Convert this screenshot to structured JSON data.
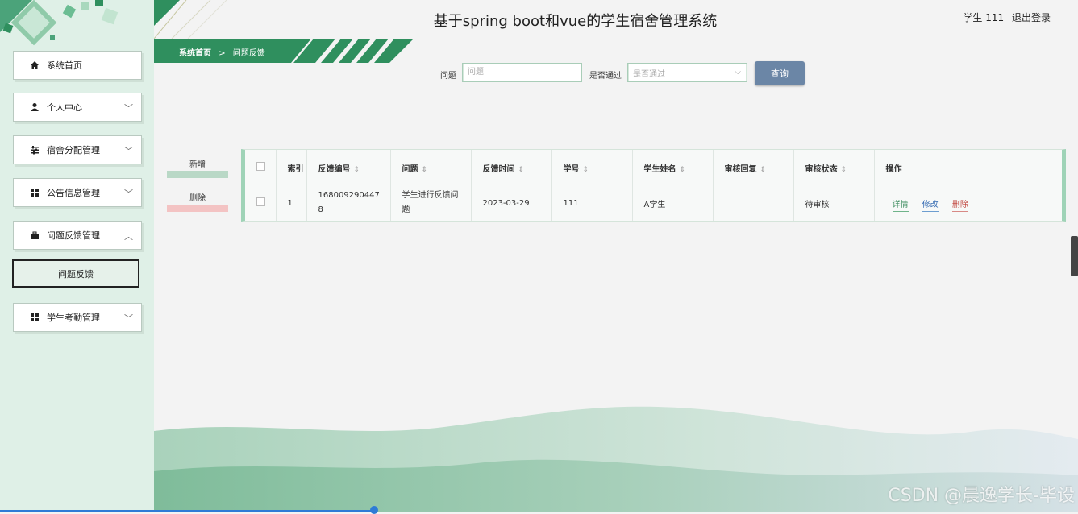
{
  "header": {
    "title": "基于spring boot和vue的学生宿舍管理系统",
    "user": "学生 111",
    "logout": "退出登录"
  },
  "breadcrumb": {
    "home": "系统首页",
    "separator": ">",
    "current": "问题反馈"
  },
  "sidebar": {
    "items": [
      {
        "label": "系统首页",
        "icon": "home-icon"
      },
      {
        "label": "个人中心",
        "icon": "user-icon",
        "arrow": "﹀"
      },
      {
        "label": "宿舍分配管理",
        "icon": "sliders-icon",
        "arrow": "﹀"
      },
      {
        "label": "公告信息管理",
        "icon": "grid-icon",
        "arrow": "﹀"
      },
      {
        "label": "问题反馈管理",
        "icon": "briefcase-icon",
        "arrow": "︿"
      },
      {
        "label": "问题反馈",
        "icon": ""
      },
      {
        "label": "学生考勤管理",
        "icon": "grid-icon",
        "arrow": "﹀"
      }
    ]
  },
  "search": {
    "question_label": "问题",
    "question_placeholder": "问题",
    "approved_label": "是否通过",
    "approved_placeholder": "是否通过",
    "query_button": "查询"
  },
  "actions": {
    "add": "新增",
    "delete": "删除"
  },
  "table": {
    "columns": [
      "索引",
      "反馈编号",
      "问题",
      "反馈时间",
      "学号",
      "学生姓名",
      "审核回复",
      "审核状态",
      "操作"
    ],
    "rows": [
      {
        "index": "1",
        "feedback_no": "1680092904478",
        "question": "学生进行反馈问题",
        "time": "2023-03-29",
        "student_no": "111",
        "student_name": "A学生",
        "reply": "",
        "status": "待审核",
        "op_detail": "详情",
        "op_edit": "修改",
        "op_delete": "删除"
      }
    ]
  },
  "watermark": "CSDN @晨逸学长-毕设",
  "colors": {
    "sidebar_bg": "#dff0e7",
    "accent_green": "#2f8f5e",
    "query_button": "#6b86a6",
    "add_bar": "#b9d8c6",
    "delete_bar": "#f3c3c3"
  }
}
